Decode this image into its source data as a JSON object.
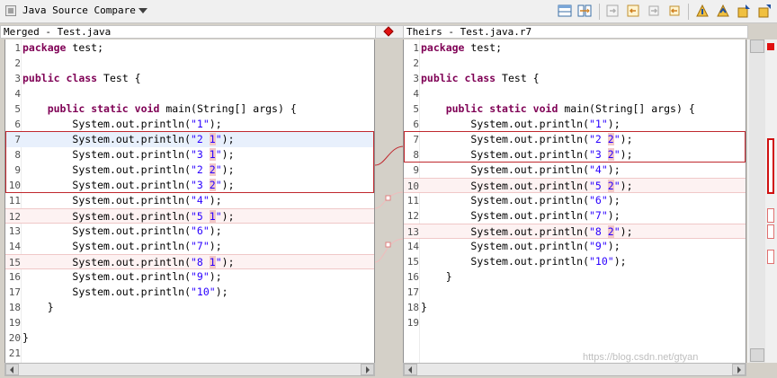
{
  "toolbar": {
    "title": "Java Source Compare",
    "dropdown_icon": "chevron-down-icon",
    "buttons": [
      {
        "icon": "layout-icon",
        "name": "toggle-layout"
      },
      {
        "icon": "swap-sides-icon",
        "name": "swap-sides"
      },
      {
        "icon": "copy-all-left-to-right-icon",
        "name": "copy-all-left-to-right"
      },
      {
        "icon": "copy-all-right-to-left-icon",
        "name": "copy-all-right-to-left"
      },
      {
        "icon": "copy-left-to-right-icon",
        "name": "copy-left-to-right"
      },
      {
        "icon": "copy-right-to-left-icon",
        "name": "copy-right-to-left"
      },
      {
        "icon": "next-difference-icon",
        "name": "next-difference"
      },
      {
        "icon": "previous-difference-icon",
        "name": "previous-difference"
      },
      {
        "icon": "next-change-icon",
        "name": "next-change"
      },
      {
        "icon": "previous-change-icon",
        "name": "previous-change"
      }
    ]
  },
  "left_pane": {
    "header": "Merged - Test.java",
    "lines": [
      {
        "n": "1",
        "code": "package test;"
      },
      {
        "n": "2",
        "code": ""
      },
      {
        "n": "3",
        "code": "public class Test {"
      },
      {
        "n": "4",
        "code": ""
      },
      {
        "n": "5",
        "code": "    public static void main(String[] args) {"
      },
      {
        "n": "6",
        "code": "        System.out.println(\"1\");"
      },
      {
        "n": "7",
        "code": "        System.out.println(\"2 1\");"
      },
      {
        "n": "8",
        "code": "        System.out.println(\"3 1\");"
      },
      {
        "n": "9",
        "code": "        System.out.println(\"2 2\");"
      },
      {
        "n": "10",
        "code": "        System.out.println(\"3 2\");"
      },
      {
        "n": "11",
        "code": "        System.out.println(\"4\");"
      },
      {
        "n": "12",
        "code": "        System.out.println(\"5 1\");"
      },
      {
        "n": "13",
        "code": "        System.out.println(\"6\");"
      },
      {
        "n": "14",
        "code": "        System.out.println(\"7\");"
      },
      {
        "n": "15",
        "code": "        System.out.println(\"8 1\");"
      },
      {
        "n": "16",
        "code": "        System.out.println(\"9\");"
      },
      {
        "n": "17",
        "code": "        System.out.println(\"10\");"
      },
      {
        "n": "18",
        "code": "    }"
      },
      {
        "n": "19",
        "code": ""
      },
      {
        "n": "20",
        "code": "}"
      },
      {
        "n": "21",
        "code": ""
      }
    ]
  },
  "right_pane": {
    "header": "Theirs - Test.java.r7",
    "lines": [
      {
        "n": "1",
        "code": "package test;"
      },
      {
        "n": "2",
        "code": ""
      },
      {
        "n": "3",
        "code": "public class Test {"
      },
      {
        "n": "4",
        "code": ""
      },
      {
        "n": "5",
        "code": "    public static void main(String[] args) {"
      },
      {
        "n": "6",
        "code": "        System.out.println(\"1\");"
      },
      {
        "n": "7",
        "code": "        System.out.println(\"2 2\");"
      },
      {
        "n": "8",
        "code": "        System.out.println(\"3 2\");"
      },
      {
        "n": "9",
        "code": "        System.out.println(\"4\");"
      },
      {
        "n": "10",
        "code": "        System.out.println(\"5 2\");"
      },
      {
        "n": "11",
        "code": "        System.out.println(\"6\");"
      },
      {
        "n": "12",
        "code": "        System.out.println(\"7\");"
      },
      {
        "n": "13",
        "code": "        System.out.println(\"8 2\");"
      },
      {
        "n": "14",
        "code": "        System.out.println(\"9\");"
      },
      {
        "n": "15",
        "code": "        System.out.println(\"10\");"
      },
      {
        "n": "16",
        "code": "    }"
      },
      {
        "n": "17",
        "code": ""
      },
      {
        "n": "18",
        "code": "}"
      },
      {
        "n": "19",
        "code": ""
      }
    ]
  },
  "keywords": [
    "package",
    "public",
    "class",
    "static",
    "void"
  ],
  "watermark": "https://blog.csdn.net/gtyan"
}
